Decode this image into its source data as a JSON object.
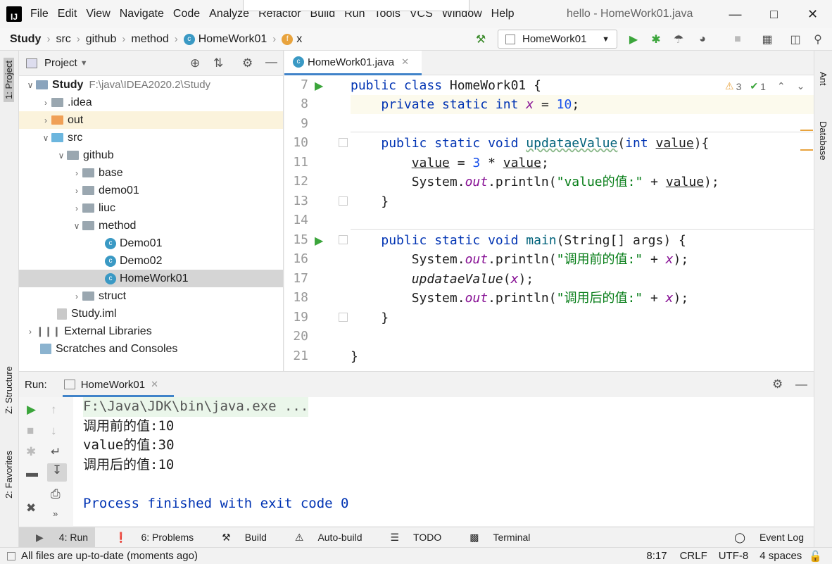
{
  "menu": {
    "items": [
      "File",
      "Edit",
      "View",
      "Navigate",
      "Code",
      "Analyze",
      "Refactor",
      "Build",
      "Run",
      "Tools",
      "VCS",
      "Window",
      "Help"
    ],
    "title": "hello - HomeWork01.java"
  },
  "breadcrumb": [
    "Study",
    "src",
    "github",
    "method",
    "HomeWork01",
    "x"
  ],
  "toolbar": {
    "run_config": "HomeWork01"
  },
  "left_tabs": {
    "project": "1: Project",
    "structure": "Z: Structure",
    "favorites": "2: Favorites"
  },
  "right_tabs": {
    "ant": "Ant",
    "database": "Database"
  },
  "project": {
    "header": "Project",
    "tree": [
      {
        "label": "Study",
        "note": "F:\\java\\IDEA2020.2\\Study"
      },
      {
        "label": ".idea"
      },
      {
        "label": "out"
      },
      {
        "label": "src"
      },
      {
        "label": "github"
      },
      {
        "label": "base"
      },
      {
        "label": "demo01"
      },
      {
        "label": "liuc"
      },
      {
        "label": "method"
      },
      {
        "label": "Demo01"
      },
      {
        "label": "Demo02"
      },
      {
        "label": "HomeWork01"
      },
      {
        "label": "struct"
      },
      {
        "label": "Study.iml"
      },
      {
        "label": "External Libraries"
      },
      {
        "label": "Scratches and Consoles"
      }
    ]
  },
  "editor": {
    "tab": "HomeWork01.java",
    "warnings": "3",
    "ok": "1",
    "line_numbers": [
      "7",
      "8",
      "9",
      "10",
      "11",
      "12",
      "13",
      "14",
      "15",
      "16",
      "17",
      "18",
      "19",
      "20",
      "21"
    ]
  },
  "run": {
    "label": "Run:",
    "tab": "HomeWork01",
    "console": [
      "F:\\Java\\JDK\\bin\\java.exe ...",
      "调用前的值:10",
      "value的值:30",
      "调用后的值:10",
      "",
      "Process finished with exit code 0"
    ]
  },
  "bottom_tools": [
    "4: Run",
    "6: Problems",
    "Build",
    "Auto-build",
    "TODO",
    "Terminal"
  ],
  "event_log": "Event Log",
  "status": {
    "message": "All files are up-to-date (moments ago)",
    "position": "8:17",
    "line_sep": "CRLF",
    "encoding": "UTF-8",
    "indent": "4 spaces"
  }
}
